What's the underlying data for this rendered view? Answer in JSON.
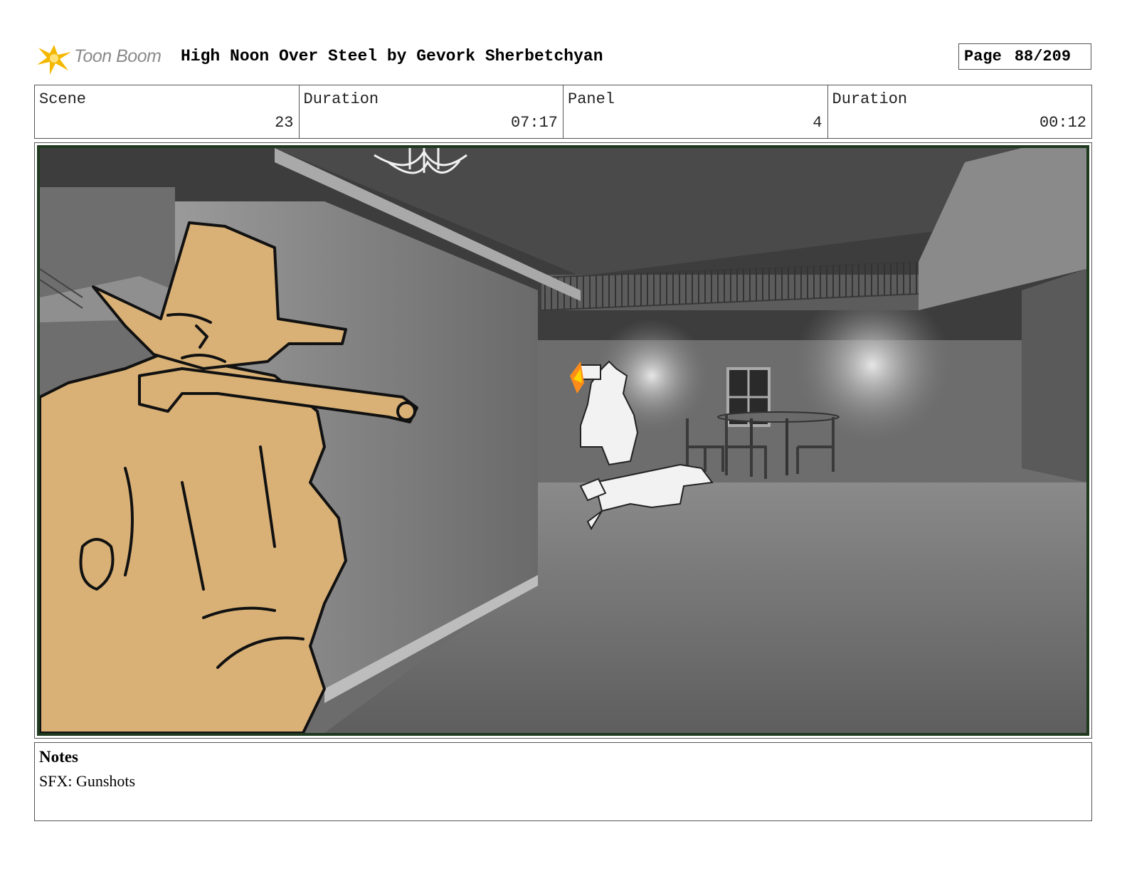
{
  "header": {
    "logo_text": "Toon Boom",
    "title": "High Noon Over Steel by Gevork Sherbetchyan",
    "page_label": "Page",
    "page_number": "88/209"
  },
  "info": {
    "scene_label": "Scene",
    "scene_value": "23",
    "scene_duration_label": "Duration",
    "scene_duration_value": "07:17",
    "panel_label": "Panel",
    "panel_value": "4",
    "panel_duration_label": "Duration",
    "panel_duration_value": "00:12"
  },
  "notes": {
    "title": "Notes",
    "text": "SFX: Gunshots"
  },
  "colors": {
    "logo_accent": "#f5b800",
    "frame_border": "#1f3a1f",
    "cowboy_fill": "#d9b176"
  }
}
